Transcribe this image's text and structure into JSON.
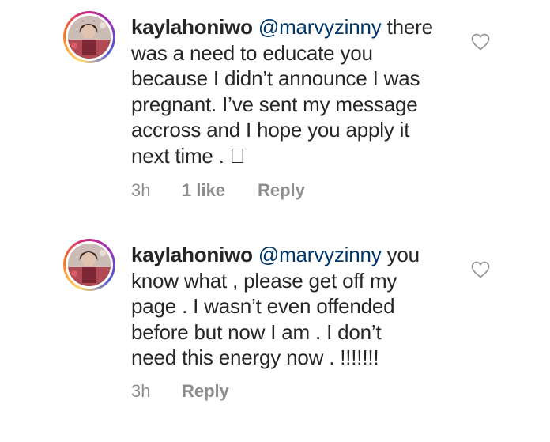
{
  "comments": [
    {
      "username": "kaylahoniwo",
      "mention": "@marvyzinny",
      "lines": [
        " there",
        "was a need to educate you",
        "because I didn’t announce I was",
        "pregnant. I’ve sent my message",
        "accross and I hope you apply it",
        "next time . \u0000"
      ],
      "time": "3h",
      "likes": "1 like",
      "reply": "Reply"
    },
    {
      "username": "kaylahoniwo",
      "mention": "@marvyzinny",
      "lines": [
        " you",
        "know what , please get off my",
        "page . I wasn’t even offended",
        "before but now I am . I don’t",
        "need this energy now . !!!!!!!"
      ],
      "time": "3h",
      "reply": "Reply"
    }
  ],
  "icons": {
    "like": "heart-outline-icon",
    "avatar": "profile-avatar"
  },
  "colors": {
    "text": "#262626",
    "mention": "#00376b",
    "meta": "#8e8e8e"
  }
}
